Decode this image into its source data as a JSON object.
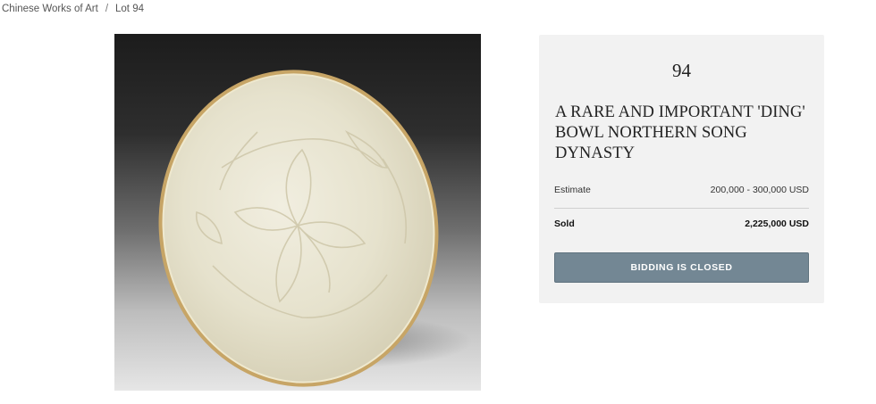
{
  "breadcrumb": {
    "category": "Chinese Works of Art",
    "separator": "/",
    "current": "Lot 94"
  },
  "lot": {
    "number": "94",
    "title": "A RARE AND IMPORTANT 'DING' BOWL NORTHERN SONG DYNASTY"
  },
  "estimate": {
    "label": "Estimate",
    "value": "200,000 - 300,000 USD"
  },
  "sold": {
    "label": "Sold",
    "value": "2,225,000 USD"
  },
  "bid_button": {
    "label": "BIDDING IS CLOSED"
  },
  "colors": {
    "panel_bg": "#f2f2f2",
    "button_bg": "#738794",
    "glaze": "#e9e6d4",
    "rim": "#c7a566"
  }
}
